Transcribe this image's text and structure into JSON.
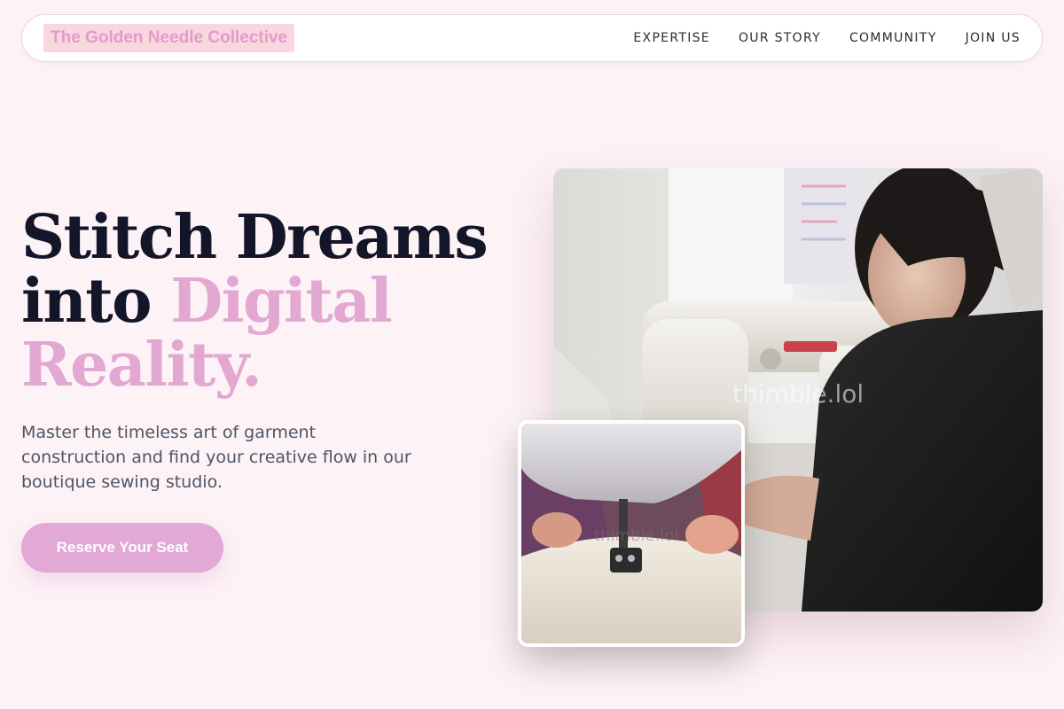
{
  "header": {
    "brand": "The Golden Needle Collective",
    "nav": [
      {
        "label": "EXPERTISE"
      },
      {
        "label": "OUR STORY"
      },
      {
        "label": "COMMUNITY"
      },
      {
        "label": "JOIN US"
      }
    ]
  },
  "hero": {
    "headline_line1": "Stitch Dreams",
    "headline_line2_plain": "into ",
    "headline_line2_accent": "Digital",
    "headline_line3_accent": "Reality.",
    "description": "Master the timeless art of garment construction and find your creative flow in our boutique sewing studio.",
    "cta_label": "Reserve Your Seat"
  },
  "images": {
    "main_watermark": "thimble.lol",
    "small_watermark": "thimble.lol"
  },
  "colors": {
    "background": "#fdf2f6",
    "accent": "#e2a8d2",
    "heading": "#121628",
    "body_text": "#4d5566",
    "brand_text": "#e19cc8",
    "brand_highlight": "#f8d7de"
  }
}
